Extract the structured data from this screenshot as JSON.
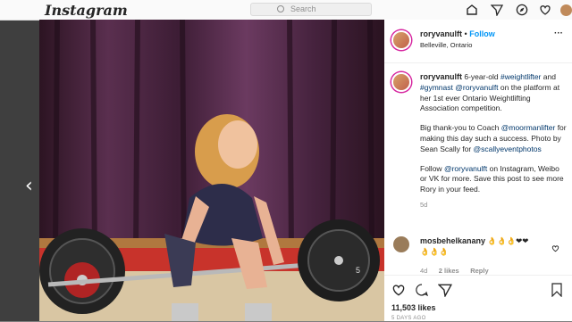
{
  "topbar": {
    "logo": "Instagram",
    "search_placeholder": "Search"
  },
  "post": {
    "username": "roryvanulft",
    "follow_label": "Follow",
    "dot": "•",
    "location": "Belleville, Ontario",
    "more": "···",
    "caption": {
      "p1": {
        "t1": " 6-year-old ",
        "h1": "#weightlifter",
        "t2": " and ",
        "h2": "#gymnast",
        "t3": " ",
        "m1": "@roryvanulft",
        "t4": " on the platform at her 1st ever Ontario Weightlifting Association competition."
      },
      "p2": {
        "t1": "Big thank-you to Coach ",
        "m1": "@moormanlifter",
        "t2": " for making this day such a success. Photo by Sean Scally for ",
        "m2": "@scallyeventphotos"
      },
      "p3": {
        "t1": "Follow ",
        "m1": "@roryvanulft",
        "t2": " on Instagram, Weibo or VK for more. Save this post to see more Rory in your feed."
      },
      "age": "5d"
    },
    "comment": {
      "user": "mosbehelkanany",
      "text": " 👌👌👌❤❤",
      "text2": "👌👌👌",
      "age": "4d",
      "likes": "2 likes",
      "reply": "Reply"
    },
    "likes": "11,503 likes",
    "date": "5 DAYS AGO"
  },
  "photo": {
    "plate_text": "5"
  }
}
